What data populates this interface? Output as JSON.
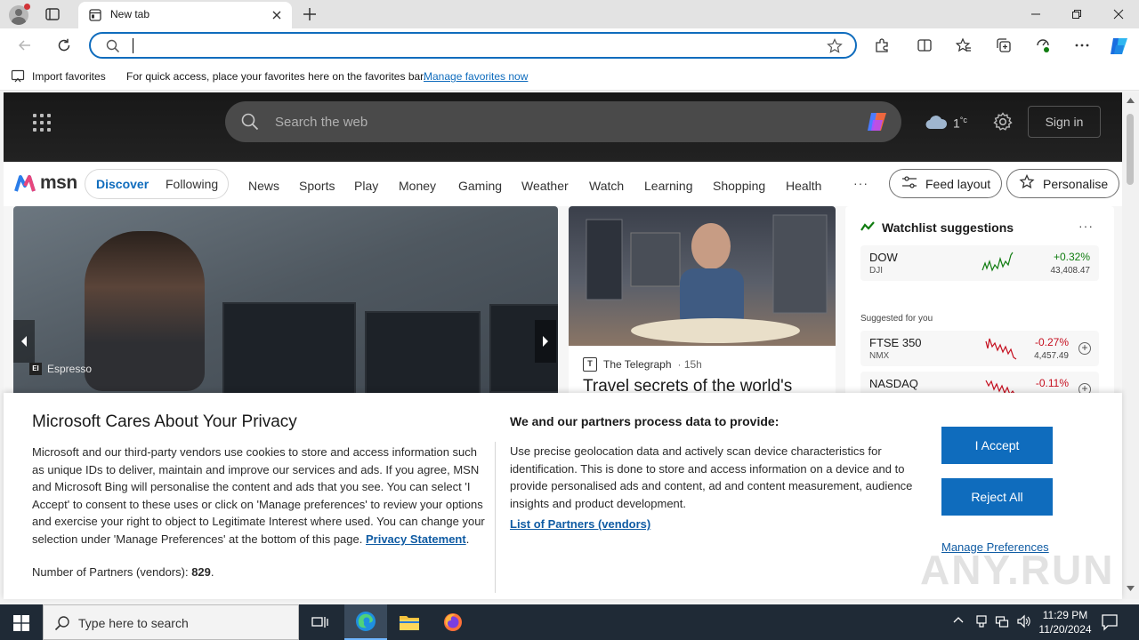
{
  "browser": {
    "tab_title": "New tab",
    "address_value": ""
  },
  "favorites_bar": {
    "import_label": "Import favorites",
    "message": "For quick access, place your favorites here on the favorites bar.",
    "manage_link": "Manage favorites now"
  },
  "msn": {
    "search_placeholder": "Search the web",
    "temperature": "1",
    "temp_unit": "°c",
    "signin": "Sign in",
    "logo_text": "msn",
    "pills": [
      "Discover",
      "Following"
    ],
    "nav": [
      "News",
      "Sports",
      "Play",
      "Money",
      "Gaming",
      "Weather",
      "Watch",
      "Learning",
      "Shopping",
      "Health"
    ],
    "more": "···",
    "feed_layout": "Feed layout",
    "personalise": "Personalise",
    "hero_source": "Espresso",
    "hero_badge": "EI",
    "card2_source": "The Telegraph",
    "card2_time": "· 15h",
    "card2_headline": "Travel secrets of the world's",
    "watchlist": {
      "title": "Watchlist suggestions",
      "more": "···",
      "suggested_label": "Suggested for you",
      "stocks": [
        {
          "symbol": "DOW",
          "exchange": "DJI",
          "change": "+0.32%",
          "price": "43,408.47",
          "color": "#107c10"
        },
        {
          "symbol": "FTSE 350",
          "exchange": "NMX",
          "change": "-0.27%",
          "price": "4,457.49",
          "color": "#c50f1f"
        },
        {
          "symbol": "NASDAQ",
          "exchange": "",
          "change": "-0.11%",
          "price": "",
          "color": "#c50f1f"
        }
      ]
    }
  },
  "privacy": {
    "title": "Microsoft Cares About Your Privacy",
    "body": "Microsoft and our third-party vendors use cookies to store and access information such as unique IDs to deliver, maintain and improve our services and ads. If you agree, MSN and Microsoft Bing will personalise the content and ads that you see. You can select 'I Accept' to consent to these uses or click on 'Manage preferences' to review your options and exercise your right to object to Legitimate Interest where used.  You can change your selection under 'Manage Preferences' at the bottom of this page.",
    "privacy_link": "Privacy Statement",
    "partners_label": "Number of Partners (vendors):",
    "partners_count": "829",
    "subtitle": "We and our partners process data to provide:",
    "description": "Use precise geolocation data and actively scan device characteristics for identification. This is done to store and access information on a device and to provide personalised ads and content, ad and content measurement, audience insights and product development.",
    "list_link": "List of Partners (vendors)",
    "accept": "I Accept",
    "reject": "Reject All",
    "manage": "Manage Preferences",
    "watermark": "ANY.RUN"
  },
  "taskbar": {
    "search_placeholder": "Type here to search",
    "time": "11:29 PM",
    "date": "11/20/2024"
  },
  "colors": {
    "accent": "#0f6cbd",
    "taskbar": "#1f2a36"
  }
}
